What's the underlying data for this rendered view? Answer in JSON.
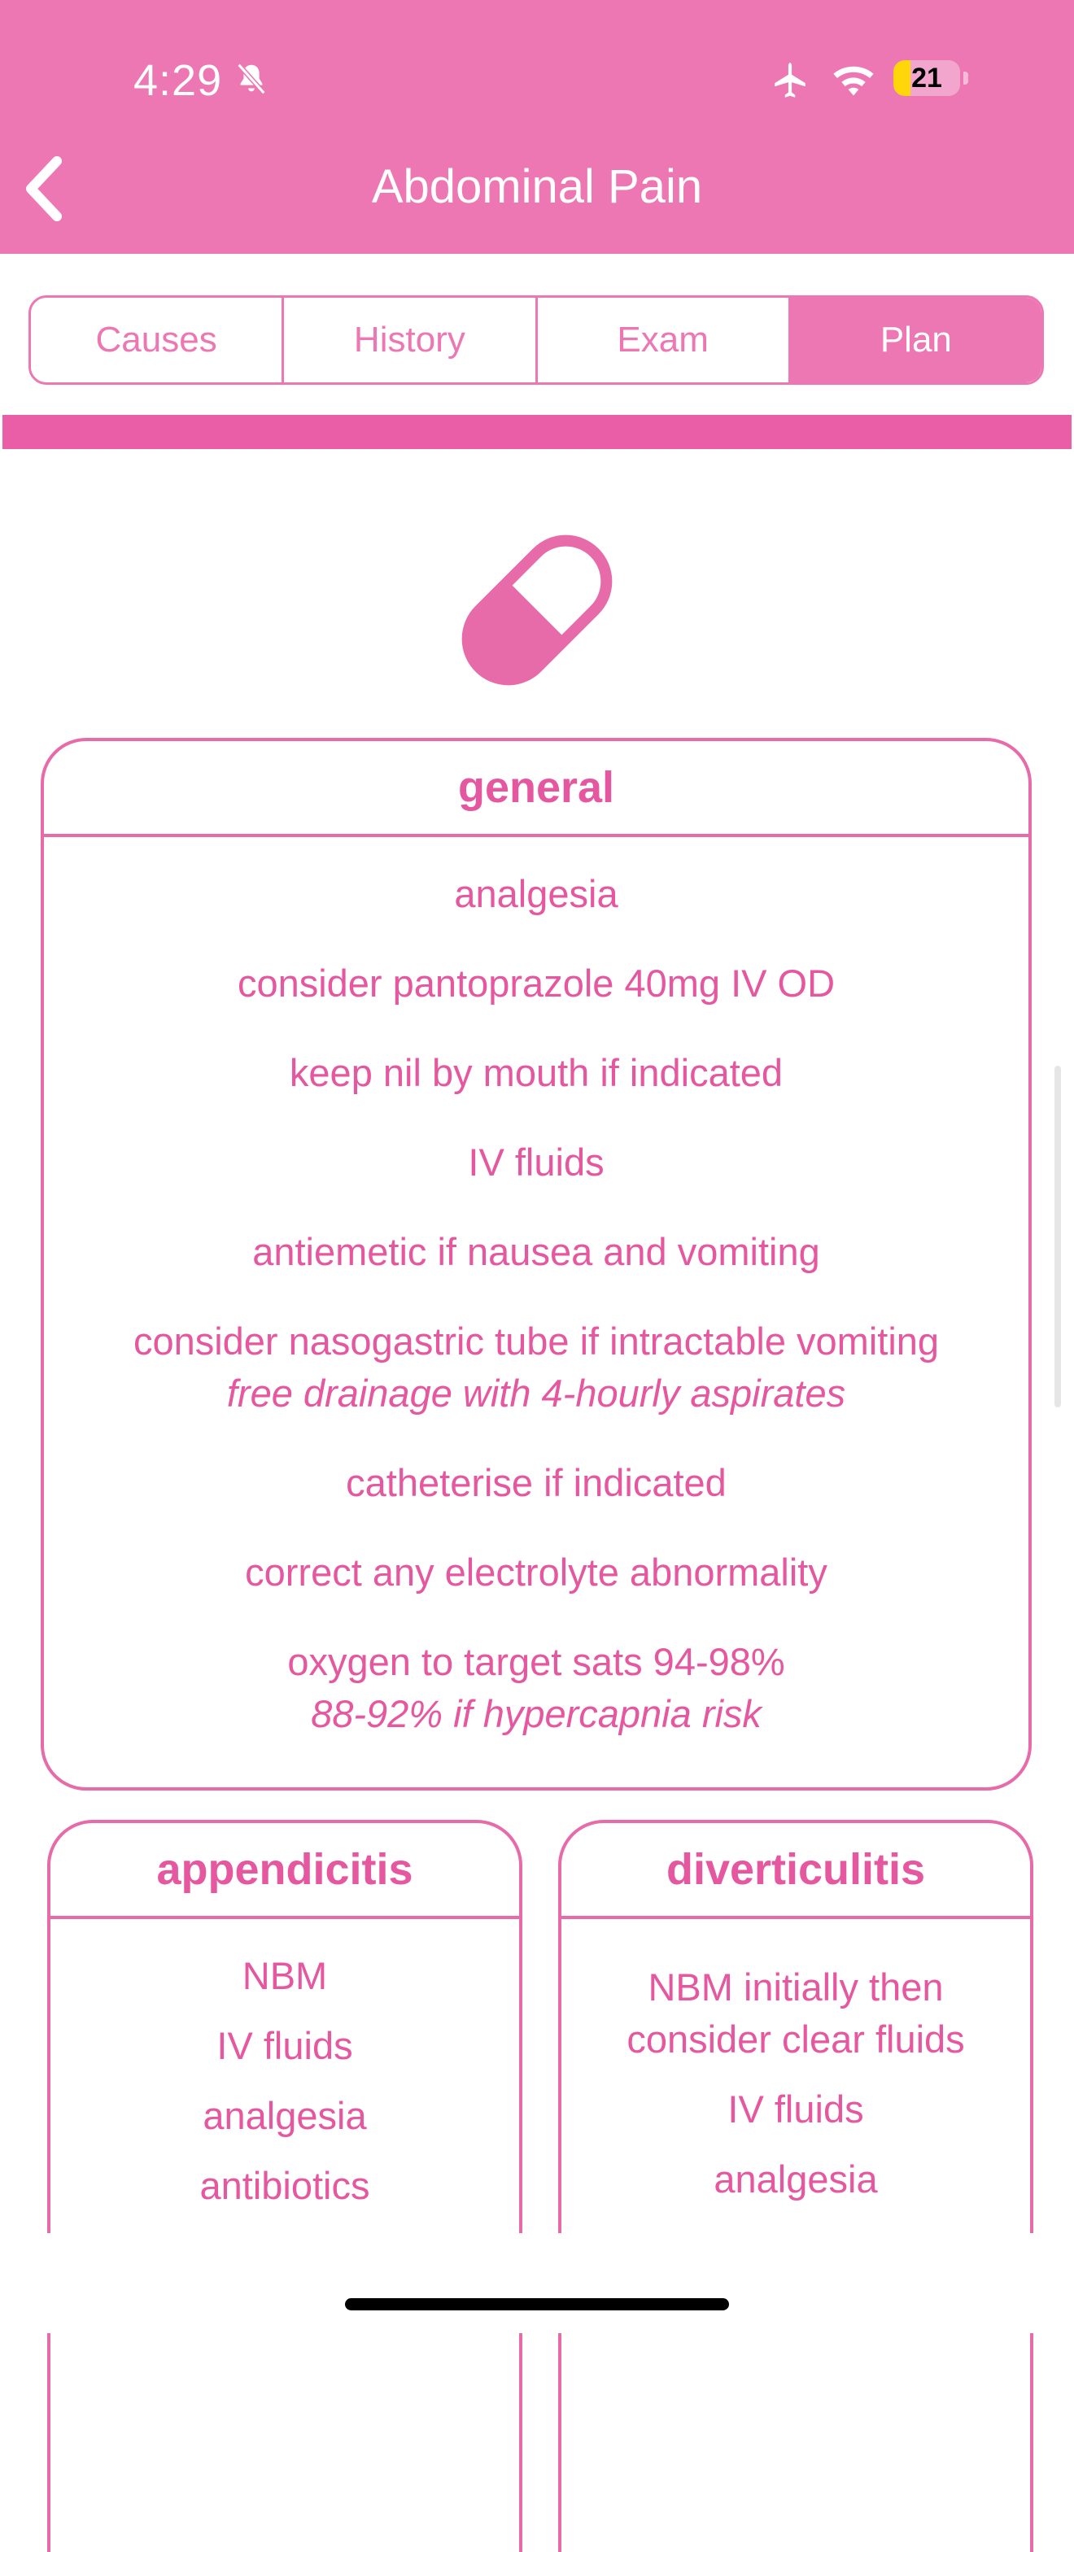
{
  "status_bar": {
    "time": "4:29",
    "battery": "21",
    "battery_level": 0.21
  },
  "nav": {
    "title": "Abdominal Pain"
  },
  "tabs": [
    {
      "label": "Causes",
      "active": false
    },
    {
      "label": "History",
      "active": false
    },
    {
      "label": "Exam",
      "active": false
    },
    {
      "label": "Plan",
      "active": true
    }
  ],
  "icon": "pill-capsule-icon",
  "general": {
    "title": "general",
    "items": [
      {
        "text": "analgesia"
      },
      {
        "text": "consider pantoprazole 40mg IV OD"
      },
      {
        "text": "keep nil by mouth if indicated"
      },
      {
        "text": "IV fluids"
      },
      {
        "text": "antiemetic if nausea and vomiting"
      },
      {
        "text": "consider nasogastric tube if intractable vomiting",
        "sub": "free drainage with 4-hourly aspirates"
      },
      {
        "text": "catheterise if indicated"
      },
      {
        "text": "correct any electrolyte abnormality"
      },
      {
        "text": "oxygen to target sats 94-98%",
        "sub": "88-92% if hypercapnia risk"
      }
    ]
  },
  "appendicitis": {
    "title": "appendicitis",
    "items": [
      "NBM",
      "IV fluids",
      "analgesia",
      "antibiotics"
    ]
  },
  "diverticulitis": {
    "title": "diverticulitis",
    "items": [
      "NBM initially then consider clear fluids",
      "IV fluids",
      "analgesia"
    ]
  },
  "colors": {
    "header": "#ec77b3",
    "accent": "#e5579f",
    "bar": "#e95ea7"
  }
}
